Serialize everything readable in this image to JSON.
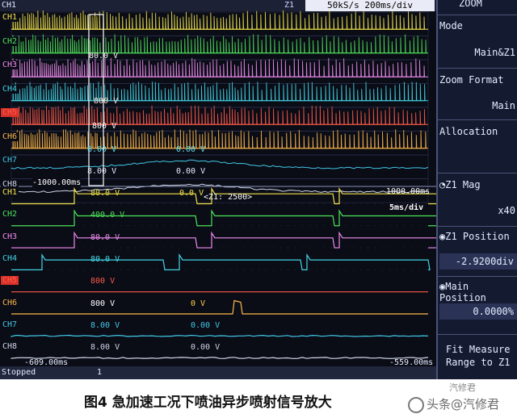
{
  "topbar": {
    "left_text": "CH1",
    "rate_text": "50kS/s  200ms/div",
    "zoom_marker": "Z1"
  },
  "panel": {
    "zoom_header": "ZOOM",
    "mode_label": "Mode",
    "mode_value": "Main&Z1",
    "zoom_format_label": "Zoom Format",
    "zoom_format_value": "Main",
    "allocation_label": "Allocation",
    "z1_mag_label": "Z1 Mag",
    "z1_mag_value": "x40",
    "z1_position_label": "Z1 Position",
    "z1_position_value": "-2.9200div",
    "main_position_label": "Main Position",
    "main_position_value": "0.0000%",
    "fit_measure_label": "Fit Measure",
    "range_label": "Range to Z1"
  },
  "main_channels": [
    {
      "label": "CH1",
      "color": "#f2e24a"
    },
    {
      "label": "CH2",
      "color": "#4ee35a"
    },
    {
      "label": "CH3",
      "color": "#f08cf0"
    },
    {
      "label": "CH4",
      "color": "#42d6e6"
    },
    {
      "label": "CH5",
      "color": "#ff5a4a"
    },
    {
      "label": "CH6",
      "color": "#ffb84a"
    },
    {
      "label": "CH7",
      "color": "#42c8e6"
    },
    {
      "label": "CH8",
      "color": "#cfd6e8"
    }
  ],
  "main_annotations": {
    "ch3_scale": "80.0 V",
    "ch5_scale": "800 V",
    "ch6_scale": "800 V",
    "ch7_scale": "8.00 V",
    "ch7_zero": "0.00 V",
    "ch8_scale": "8.00 V",
    "ch8_zero": "0.00 V",
    "time_left": "-1000.00ms",
    "time_right": "1000.00ms"
  },
  "zoom_channels": [
    {
      "label": "CH1",
      "color": "#f2e24a",
      "scale": "80.0 V",
      "zero": "0.0 V"
    },
    {
      "label": "CH2",
      "color": "#4ee35a",
      "scale": "400.0 V",
      "zero": ""
    },
    {
      "label": "CH3",
      "color": "#f08cf0",
      "scale": "80.0 V",
      "zero": ""
    },
    {
      "label": "CH4",
      "color": "#42d6e6",
      "scale": "80.0 V",
      "zero": ""
    },
    {
      "label": "CH5",
      "color": "#ff5a4a",
      "scale": "800 V",
      "zero": ""
    },
    {
      "label": "CH6",
      "color": "#ffb84a",
      "scale": "800 V",
      "zero": "0 V"
    },
    {
      "label": "CH7",
      "color": "#42c8e6",
      "scale": "8.00 V",
      "zero": "0.00 V"
    },
    {
      "label": "CH8",
      "color": "#cfd6e8",
      "scale": "8.00 V",
      "zero": "0.00 V"
    }
  ],
  "zoom_annotations": {
    "z1_tag": "<Z1: 2500>",
    "timebase": "5ms/div",
    "time_left": "-609.00ms",
    "time_right": "-559.00ms"
  },
  "status": {
    "state": "Stopped",
    "marker": "1"
  },
  "caption": {
    "text": "图4 急加速工况下喷油异步喷射信号放大",
    "watermark": "头条@汽修君",
    "watermark_top": "汽修君"
  }
}
